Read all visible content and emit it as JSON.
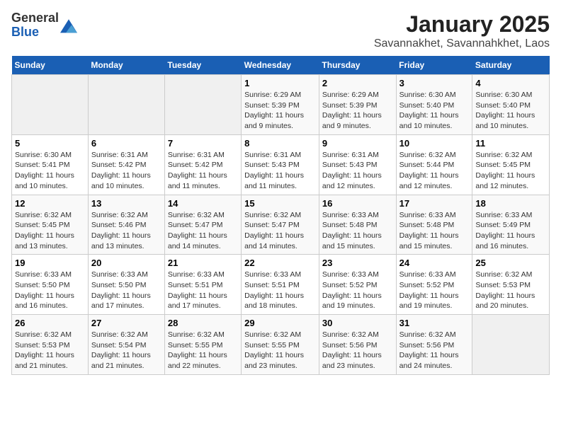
{
  "logo": {
    "general": "General",
    "blue": "Blue"
  },
  "title": "January 2025",
  "subtitle": "Savannakhet, Savannahkhet, Laos",
  "days_of_week": [
    "Sunday",
    "Monday",
    "Tuesday",
    "Wednesday",
    "Thursday",
    "Friday",
    "Saturday"
  ],
  "weeks": [
    [
      {
        "day": "",
        "info": ""
      },
      {
        "day": "",
        "info": ""
      },
      {
        "day": "",
        "info": ""
      },
      {
        "day": "1",
        "info": "Sunrise: 6:29 AM\nSunset: 5:39 PM\nDaylight: 11 hours and 9 minutes."
      },
      {
        "day": "2",
        "info": "Sunrise: 6:29 AM\nSunset: 5:39 PM\nDaylight: 11 hours and 9 minutes."
      },
      {
        "day": "3",
        "info": "Sunrise: 6:30 AM\nSunset: 5:40 PM\nDaylight: 11 hours and 10 minutes."
      },
      {
        "day": "4",
        "info": "Sunrise: 6:30 AM\nSunset: 5:40 PM\nDaylight: 11 hours and 10 minutes."
      }
    ],
    [
      {
        "day": "5",
        "info": "Sunrise: 6:30 AM\nSunset: 5:41 PM\nDaylight: 11 hours and 10 minutes."
      },
      {
        "day": "6",
        "info": "Sunrise: 6:31 AM\nSunset: 5:42 PM\nDaylight: 11 hours and 10 minutes."
      },
      {
        "day": "7",
        "info": "Sunrise: 6:31 AM\nSunset: 5:42 PM\nDaylight: 11 hours and 11 minutes."
      },
      {
        "day": "8",
        "info": "Sunrise: 6:31 AM\nSunset: 5:43 PM\nDaylight: 11 hours and 11 minutes."
      },
      {
        "day": "9",
        "info": "Sunrise: 6:31 AM\nSunset: 5:43 PM\nDaylight: 11 hours and 12 minutes."
      },
      {
        "day": "10",
        "info": "Sunrise: 6:32 AM\nSunset: 5:44 PM\nDaylight: 11 hours and 12 minutes."
      },
      {
        "day": "11",
        "info": "Sunrise: 6:32 AM\nSunset: 5:45 PM\nDaylight: 11 hours and 12 minutes."
      }
    ],
    [
      {
        "day": "12",
        "info": "Sunrise: 6:32 AM\nSunset: 5:45 PM\nDaylight: 11 hours and 13 minutes."
      },
      {
        "day": "13",
        "info": "Sunrise: 6:32 AM\nSunset: 5:46 PM\nDaylight: 11 hours and 13 minutes."
      },
      {
        "day": "14",
        "info": "Sunrise: 6:32 AM\nSunset: 5:47 PM\nDaylight: 11 hours and 14 minutes."
      },
      {
        "day": "15",
        "info": "Sunrise: 6:32 AM\nSunset: 5:47 PM\nDaylight: 11 hours and 14 minutes."
      },
      {
        "day": "16",
        "info": "Sunrise: 6:33 AM\nSunset: 5:48 PM\nDaylight: 11 hours and 15 minutes."
      },
      {
        "day": "17",
        "info": "Sunrise: 6:33 AM\nSunset: 5:48 PM\nDaylight: 11 hours and 15 minutes."
      },
      {
        "day": "18",
        "info": "Sunrise: 6:33 AM\nSunset: 5:49 PM\nDaylight: 11 hours and 16 minutes."
      }
    ],
    [
      {
        "day": "19",
        "info": "Sunrise: 6:33 AM\nSunset: 5:50 PM\nDaylight: 11 hours and 16 minutes."
      },
      {
        "day": "20",
        "info": "Sunrise: 6:33 AM\nSunset: 5:50 PM\nDaylight: 11 hours and 17 minutes."
      },
      {
        "day": "21",
        "info": "Sunrise: 6:33 AM\nSunset: 5:51 PM\nDaylight: 11 hours and 17 minutes."
      },
      {
        "day": "22",
        "info": "Sunrise: 6:33 AM\nSunset: 5:51 PM\nDaylight: 11 hours and 18 minutes."
      },
      {
        "day": "23",
        "info": "Sunrise: 6:33 AM\nSunset: 5:52 PM\nDaylight: 11 hours and 19 minutes."
      },
      {
        "day": "24",
        "info": "Sunrise: 6:33 AM\nSunset: 5:52 PM\nDaylight: 11 hours and 19 minutes."
      },
      {
        "day": "25",
        "info": "Sunrise: 6:32 AM\nSunset: 5:53 PM\nDaylight: 11 hours and 20 minutes."
      }
    ],
    [
      {
        "day": "26",
        "info": "Sunrise: 6:32 AM\nSunset: 5:53 PM\nDaylight: 11 hours and 21 minutes."
      },
      {
        "day": "27",
        "info": "Sunrise: 6:32 AM\nSunset: 5:54 PM\nDaylight: 11 hours and 21 minutes."
      },
      {
        "day": "28",
        "info": "Sunrise: 6:32 AM\nSunset: 5:55 PM\nDaylight: 11 hours and 22 minutes."
      },
      {
        "day": "29",
        "info": "Sunrise: 6:32 AM\nSunset: 5:55 PM\nDaylight: 11 hours and 23 minutes."
      },
      {
        "day": "30",
        "info": "Sunrise: 6:32 AM\nSunset: 5:56 PM\nDaylight: 11 hours and 23 minutes."
      },
      {
        "day": "31",
        "info": "Sunrise: 6:32 AM\nSunset: 5:56 PM\nDaylight: 11 hours and 24 minutes."
      },
      {
        "day": "",
        "info": ""
      }
    ]
  ]
}
